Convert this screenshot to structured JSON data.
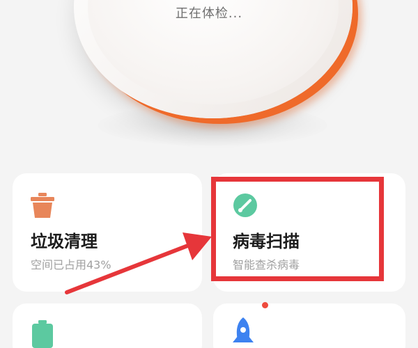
{
  "scan": {
    "status_text": "正在体检..."
  },
  "cards": {
    "trash": {
      "title": "垃圾清理",
      "subtitle": "空间已占用43%",
      "icon": "trash-can-icon"
    },
    "virus": {
      "title": "病毒扫描",
      "subtitle": "智能查杀病毒",
      "icon": "virus-scan-gauge-icon"
    },
    "bottom_left": {
      "icon": "battery-icon"
    },
    "bottom_right": {
      "icon": "rocket-icon",
      "has_notification_dot": true
    }
  },
  "colors": {
    "accent_orange": "#ef6a2a",
    "trash_icon": "#e8865a",
    "virus_icon": "#5cc9a0",
    "battery_icon": "#5cc9a0",
    "rocket_icon": "#3d82f0",
    "annotation_red": "#e6363a"
  }
}
